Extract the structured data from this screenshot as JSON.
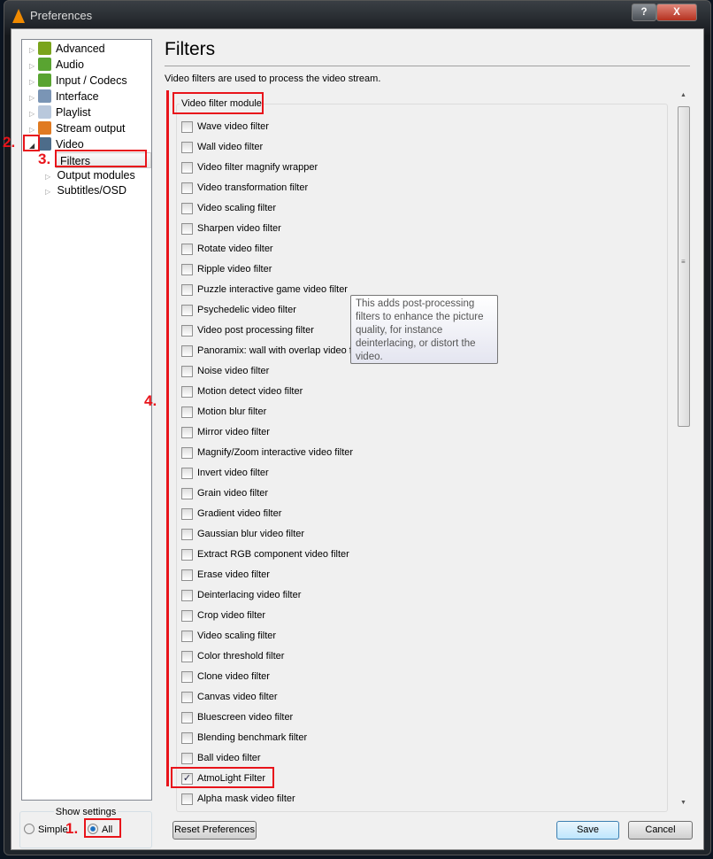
{
  "window": {
    "title": "Preferences",
    "help": "?",
    "close": "X"
  },
  "tree": [
    {
      "label": "Advanced",
      "icon": "chip-icon",
      "color": "#7aa41c"
    },
    {
      "label": "Audio",
      "icon": "music-note-icon",
      "color": "#59a431"
    },
    {
      "label": "Input / Codecs",
      "icon": "codec-icon",
      "color": "#59a431"
    },
    {
      "label": "Interface",
      "icon": "interface-icon",
      "color": "#7a95b5"
    },
    {
      "label": "Playlist",
      "icon": "playlist-icon",
      "color": "#b9c8dc"
    },
    {
      "label": "Stream output",
      "icon": "stream-icon",
      "color": "#e07a22"
    },
    {
      "label": "Video",
      "icon": "film-icon",
      "color": "#4d6c8a"
    }
  ],
  "video_children": [
    "Filters",
    "Output modules",
    "Subtitles/OSD"
  ],
  "main": {
    "title": "Filters",
    "description": "Video filters are used to process the video stream.",
    "group_label": "Video filter module"
  },
  "filters": [
    {
      "label": "Wave video filter",
      "checked": false
    },
    {
      "label": "Wall video filter",
      "checked": false
    },
    {
      "label": "Video filter magnify wrapper",
      "checked": false
    },
    {
      "label": "Video transformation filter",
      "checked": false
    },
    {
      "label": "Video scaling filter",
      "checked": false
    },
    {
      "label": "Sharpen video filter",
      "checked": false
    },
    {
      "label": "Rotate video filter",
      "checked": false
    },
    {
      "label": "Ripple video filter",
      "checked": false
    },
    {
      "label": "Puzzle interactive game video filter",
      "checked": false
    },
    {
      "label": "Psychedelic video filter",
      "checked": false
    },
    {
      "label": "Video post processing filter",
      "checked": false
    },
    {
      "label": "Panoramix: wall with overlap video filter",
      "checked": false
    },
    {
      "label": "Noise video filter",
      "checked": false
    },
    {
      "label": "Motion detect video filter",
      "checked": false
    },
    {
      "label": "Motion blur filter",
      "checked": false
    },
    {
      "label": "Mirror video filter",
      "checked": false
    },
    {
      "label": "Magnify/Zoom interactive video filter",
      "checked": false
    },
    {
      "label": "Invert video filter",
      "checked": false
    },
    {
      "label": "Grain video filter",
      "checked": false
    },
    {
      "label": "Gradient video filter",
      "checked": false
    },
    {
      "label": "Gaussian blur video filter",
      "checked": false
    },
    {
      "label": "Extract RGB component video filter",
      "checked": false
    },
    {
      "label": "Erase video filter",
      "checked": false
    },
    {
      "label": "Deinterlacing video filter",
      "checked": false
    },
    {
      "label": "Crop video filter",
      "checked": false
    },
    {
      "label": "Video scaling filter",
      "checked": false
    },
    {
      "label": "Color threshold filter",
      "checked": false
    },
    {
      "label": "Clone video filter",
      "checked": false
    },
    {
      "label": "Canvas video filter",
      "checked": false
    },
    {
      "label": "Bluescreen video filter",
      "checked": false
    },
    {
      "label": "Blending benchmark filter",
      "checked": false
    },
    {
      "label": "Ball video filter",
      "checked": false
    },
    {
      "label": "AtmoLight Filter",
      "checked": true
    },
    {
      "label": "Alpha mask video filter",
      "checked": false
    }
  ],
  "tooltip": "This adds post-processing filters to enhance the picture quality, for instance deinterlacing, or distort the video.",
  "show_settings": {
    "label": "Show settings",
    "simple": "Simple",
    "all": "All",
    "selected": "All"
  },
  "buttons": {
    "reset": "Reset Preferences",
    "save": "Save",
    "cancel": "Cancel"
  },
  "annotations": [
    "1.",
    "2.",
    "3.",
    "4."
  ],
  "colors": {
    "annotation": "#e8141b"
  }
}
